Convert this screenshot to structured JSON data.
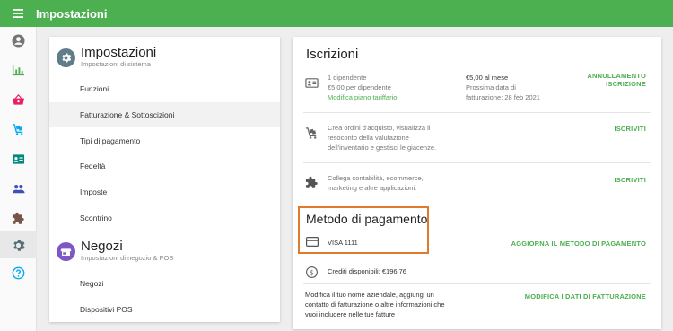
{
  "app": {
    "title": "Impostazioni"
  },
  "rail": {
    "icons": [
      "account-icon",
      "chart-icon",
      "basket-icon",
      "cart-icon",
      "id-card-icon",
      "people-icon",
      "puzzle-icon",
      "gear-icon",
      "help-icon"
    ]
  },
  "left": {
    "settings": {
      "title": "Impostazioni",
      "subtitle": "Impostazioni di sistema",
      "items": [
        "Funzioni",
        "Fatturazione & Sottoscizioni",
        "Tipi di pagamento",
        "Fedeltà",
        "Imposte",
        "Scontrino"
      ]
    },
    "stores": {
      "title": "Negozi",
      "subtitle": "Impostazioni di negozio & POS",
      "items": [
        "Negozi",
        "Dispositivi POS"
      ]
    }
  },
  "right": {
    "title": "Iscrizioni",
    "sub1": {
      "line1": "1 dipendente",
      "line2": "€5,00 per dipendente",
      "link": "Modifica piano tariffario",
      "price": "€5,00 al mese",
      "next_line1": "Prossima data di",
      "next_line2": "fatturazione: 28 feb 2021",
      "action_line1": "ANNULLAMENTO",
      "action_line2": "ISCRIZIONE"
    },
    "sub2": {
      "line1": "Crea ordini d'acquisto, visualizza il",
      "line2": "resoconto della valutazione",
      "line3": "dell'inventario e gestisci le giacenze.",
      "action": "ISCRIVITI"
    },
    "sub3": {
      "line1": "Collega contabilità, ecommerce,",
      "line2": "marketing e altre applicazioni.",
      "action": "ISCRIVITI"
    },
    "payment": {
      "title": "Metodo di pagamento",
      "card": "VISA 1111",
      "action": "AGGIORNA IL METODO DI PAGAMENTO"
    },
    "credits": {
      "label": "Crediti disponibili: €196,76"
    },
    "billing": {
      "line1": "Modifica il tuo nome aziendale, aggiungi un",
      "line2": "contatto di fatturazione o altre informazioni che",
      "line3": "vuoi includere nelle tue fatture",
      "action": "MODIFICA I DATI DI FATTURAZIONE"
    }
  },
  "colors": {
    "brand_green": "#4caf50",
    "highlight_orange": "#e07b2e",
    "basket_pink": "#e91e63",
    "help_blue": "#03a9f4"
  }
}
